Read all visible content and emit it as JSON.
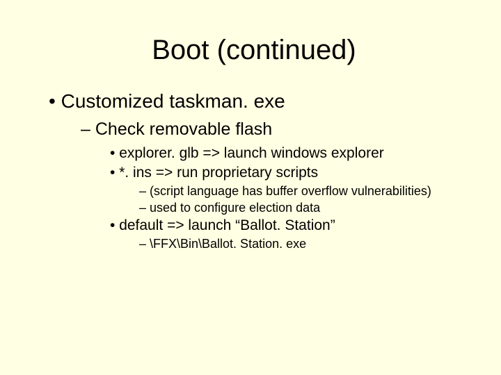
{
  "title": "Boot (continued)",
  "l1_1": "Customized taskman. exe",
  "l2_1": "Check removable flash",
  "l3_1": "explorer. glb => launch windows explorer",
  "l3_2": "*. ins => run proprietary scripts",
  "l4_1": "(script language has buffer overflow vulnerabilities)",
  "l4_2": "used to configure election data",
  "l3_3": "default => launch “Ballot. Station”",
  "l4_3": "\\FFX\\Bin\\Ballot. Station. exe"
}
